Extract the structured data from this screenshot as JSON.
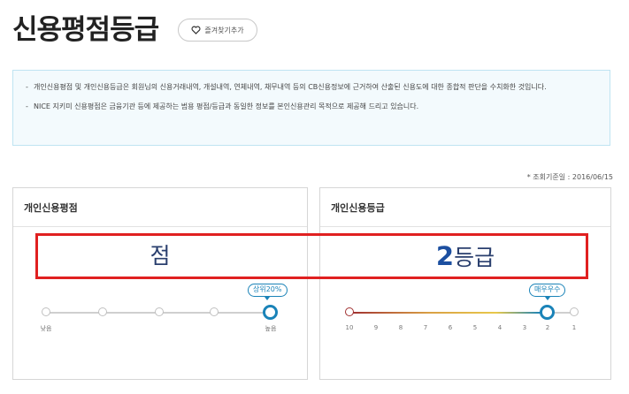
{
  "header": {
    "title": "신용평점등급",
    "favorite_label": "즐겨찾기추가"
  },
  "notice": {
    "lines": [
      "개인신용평점 및 개인신용등급은 회원님의 신용거래내역, 개설내역, 연체내역, 채무내역 등의 CB신용정보에 근거하여 산출된 신용도에 대한 종합적 판단을 수치화한 것입니다.",
      "NICE 지키미 신용평점은 금융기관 등에 제공하는 범용 평점/등급과 동일한 정보를 본인신용관리 목적으로 제공해 드리고 있습니다."
    ],
    "bullet": "-"
  },
  "query_date": "* 조회기준일 : 2016/06/15",
  "score_card": {
    "title": "개인신용평점",
    "value_unit": "점",
    "bubble": "상위20%",
    "low_label": "낮음",
    "high_label": "높음",
    "steps": 5,
    "active_step": 5
  },
  "grade_card": {
    "title": "개인신용등급",
    "grade_number": "2",
    "grade_unit": "등급",
    "bubble": "매우우수",
    "ticks": [
      "10",
      "9",
      "8",
      "7",
      "6",
      "5",
      "4",
      "3",
      "2",
      "1"
    ],
    "active_grade": "2"
  },
  "colors": {
    "accent": "#1a83b8",
    "highlight": "#e02020",
    "notice_bg": "#f3fafd",
    "grade_gradient": [
      "#a03030",
      "#e0a040",
      "#e8c84a",
      "#1a83b8"
    ]
  }
}
